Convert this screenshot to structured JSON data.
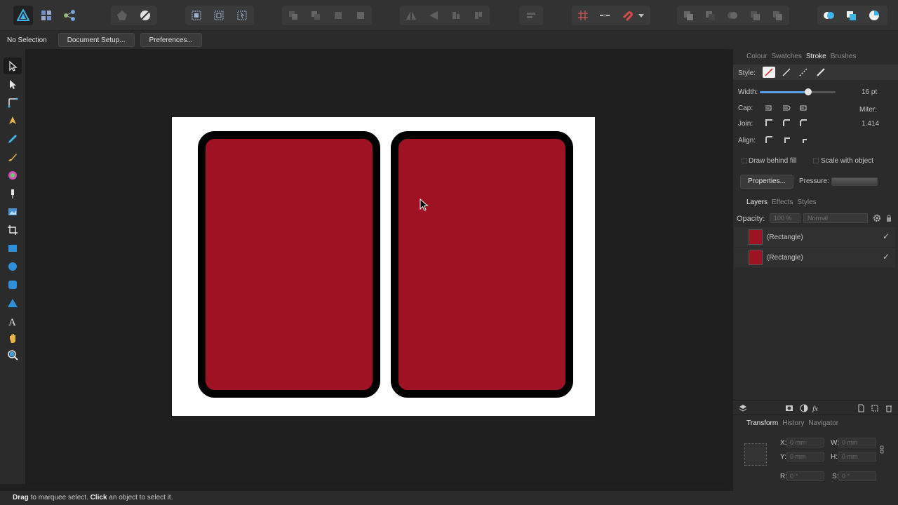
{
  "context": {
    "selection": "No Selection",
    "document_setup": "Document Setup...",
    "preferences": "Preferences..."
  },
  "canvas": {
    "card_color": "#9e1224",
    "stroke_color": "#000000"
  },
  "stroke_panel": {
    "tabs": [
      "Colour",
      "Swatches",
      "Stroke",
      "Brushes"
    ],
    "active_tab": "Stroke",
    "style_label": "Style:",
    "width_label": "Width:",
    "width_value": "16 pt",
    "width_fraction": 0.6,
    "cap_label": "Cap:",
    "join_label": "Join:",
    "align_label": "Align:",
    "miter_label": "Miter:",
    "miter_value": "1.414",
    "draw_behind_fill": "Draw behind fill",
    "scale_with_object": "Scale with object",
    "properties_button": "Properties...",
    "pressure_label": "Pressure:"
  },
  "layers_panel": {
    "tabs": [
      "Layers",
      "Effects",
      "Styles"
    ],
    "opacity_label": "Opacity:",
    "opacity_value": "100 %",
    "blend_mode": "Normal",
    "layers": [
      {
        "name": "(Rectangle)",
        "visible": "✓"
      },
      {
        "name": "(Rectangle)",
        "visible": "✓"
      }
    ]
  },
  "transform_panel": {
    "tabs": [
      "Transform",
      "History",
      "Navigator"
    ],
    "x_label": "X:",
    "x_value": "0 mm",
    "y_label": "Y:",
    "y_value": "0 mm",
    "w_label": "W:",
    "w_value": "0 mm",
    "h_label": "H:",
    "h_value": "0 mm",
    "r_label": "R:",
    "r_value": "0 °",
    "s_label": "S:",
    "s_value": "0 °"
  },
  "status": {
    "drag": "Drag",
    "drag_text": " to marquee select. ",
    "click": "Click",
    "click_text": " an object to select it."
  },
  "accent_color": "#2fa7e0"
}
